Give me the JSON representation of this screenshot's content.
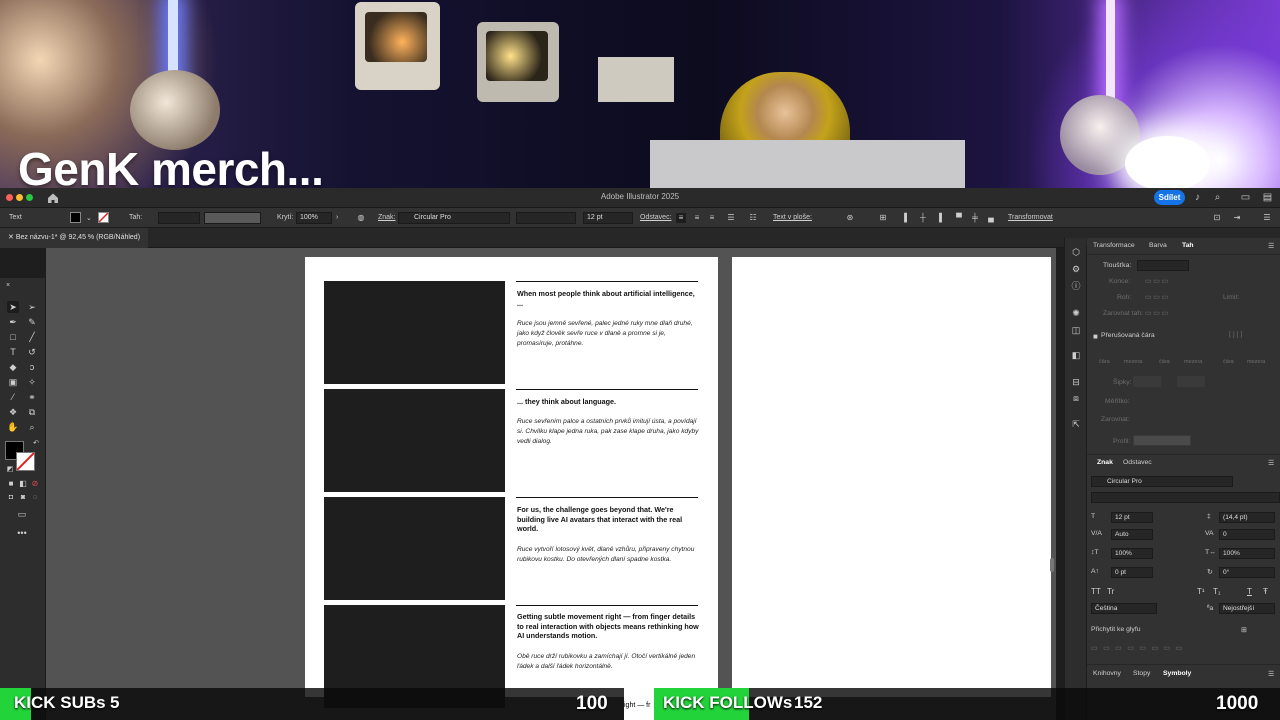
{
  "overlay": {
    "title": "GenK merch...",
    "kick_subs": {
      "label": "KICK SUBs",
      "count": "5",
      "goal": "100",
      "progress": 0.05
    },
    "kick_follows": {
      "label": "KICK FOLLOWs",
      "count": "152",
      "goal": "1000",
      "progress": 0.152
    }
  },
  "app": {
    "title": "Adobe Illustrator 2025",
    "share_label": "Sdílet",
    "doc_tab": "Bez názvu-1* @ 92,45 % (RGB/Náhled)"
  },
  "control_bar": {
    "mode": "Text",
    "stroke_label": "Tah:",
    "opacity_label": "Krytí:",
    "opacity_value": "100%",
    "char_label": "Znak:",
    "font": "Circular Pro",
    "size": "12 pt",
    "para_label": "Odstavec:",
    "on_surface_label": "Text v ploše:",
    "transform_label": "Transformovat"
  },
  "artboard": {
    "sections": [
      {
        "heading": "When most people think about artificial intelligence, ...",
        "body": "Ruce jsou jemně sevřené, palec jedné ruky mne dlaň druhé, jako když člověk sevře ruce v dlaně a promne si je, promasíruje, protáhne."
      },
      {
        "heading": "... they think about language.",
        "body": "Ruce sevřením palce a ostatních prvků imitují ústa, a povídají si. Chvilku klape jedna ruka, pak zase klape druha, jako kdyby vedli dialog."
      },
      {
        "heading": "For us, the challenge goes beyond that. We're building live AI avatars that interact with the real world.",
        "body": "Ruce vytvoří lotosový květ, dlaně vzhůru, připraveny chytnou rubikovu kostku. Do otevřených dlaní spadne kostka."
      },
      {
        "heading": "Getting subtle movement right — from finger details to real interaction with objects means rethinking how AI understands motion.",
        "body": "Obě ruce drží rubikovku a zamíchají jí. Otočí vertikálně jeden řádek a další řádek horizontálně."
      }
    ],
    "peek_text": "ight — fr"
  },
  "panel": {
    "tabs": [
      "Transformace",
      "Barva",
      "Tah"
    ],
    "active_tab": "Tah",
    "stroke": {
      "weight_label": "Tloušťka:",
      "cap_label": "Konce:",
      "corner_label": "Roh:",
      "limit_label": "Limit:",
      "align_label": "Zarovnat tah:",
      "dashed_label": "Přerušovaná čára",
      "dash_label": "čára",
      "gap_label": "mezera",
      "arrows_label": "Šipky:",
      "scale_label": "Měřítko:",
      "align2_label": "Zarovnat:",
      "profile_label": "Profil:"
    },
    "char_tabs": [
      "Znak",
      "Odstavec"
    ],
    "char_active": "Znak",
    "character": {
      "font": "Circular Pro",
      "size": "12 pt",
      "leading": "(14,4 pt)",
      "kerning": "Auto",
      "tracking": "0",
      "vscale": "100%",
      "hscale": "100%",
      "baseline": "0 pt",
      "rotation": "0°",
      "tt_caps": "TT",
      "tt_small": "Tr",
      "superscript": "T¹",
      "subscript": "T₁",
      "underline": "T",
      "strike": "Ŧ",
      "language": "Čeština",
      "aa": "Nejostřejší",
      "snap_label": "Přichytit ke glyfu"
    },
    "bottom_tabs": [
      "Knihovny",
      "Stopy",
      "Symboly"
    ],
    "bottom_active": "Symboly"
  }
}
